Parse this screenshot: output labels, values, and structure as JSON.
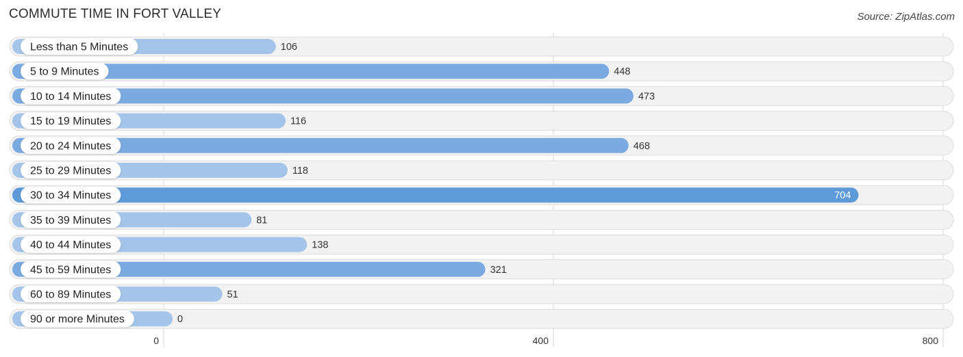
{
  "title": "COMMUTE TIME IN FORT VALLEY",
  "source": "Source: ZipAtlas.com",
  "colors": {
    "light": "#a4c4e9",
    "mid": "#7aaae0",
    "dark": "#5e9ad9",
    "track": "#f2f2f2",
    "track_border": "#dcdcdc",
    "grid": "#d4d4d4"
  },
  "chart_data": {
    "type": "bar",
    "orientation": "horizontal",
    "title": "COMMUTE TIME IN FORT VALLEY",
    "xlabel": "",
    "ylabel": "",
    "xlim": [
      0,
      800
    ],
    "xticks": [
      0,
      400,
      800
    ],
    "grid": true,
    "categories": [
      "Less than 5 Minutes",
      "5 to 9 Minutes",
      "10 to 14 Minutes",
      "15 to 19 Minutes",
      "20 to 24 Minutes",
      "25 to 29 Minutes",
      "30 to 34 Minutes",
      "35 to 39 Minutes",
      "40 to 44 Minutes",
      "45 to 59 Minutes",
      "60 to 89 Minutes",
      "90 or more Minutes"
    ],
    "values": [
      106,
      448,
      473,
      116,
      468,
      118,
      704,
      81,
      138,
      321,
      51,
      0
    ]
  }
}
